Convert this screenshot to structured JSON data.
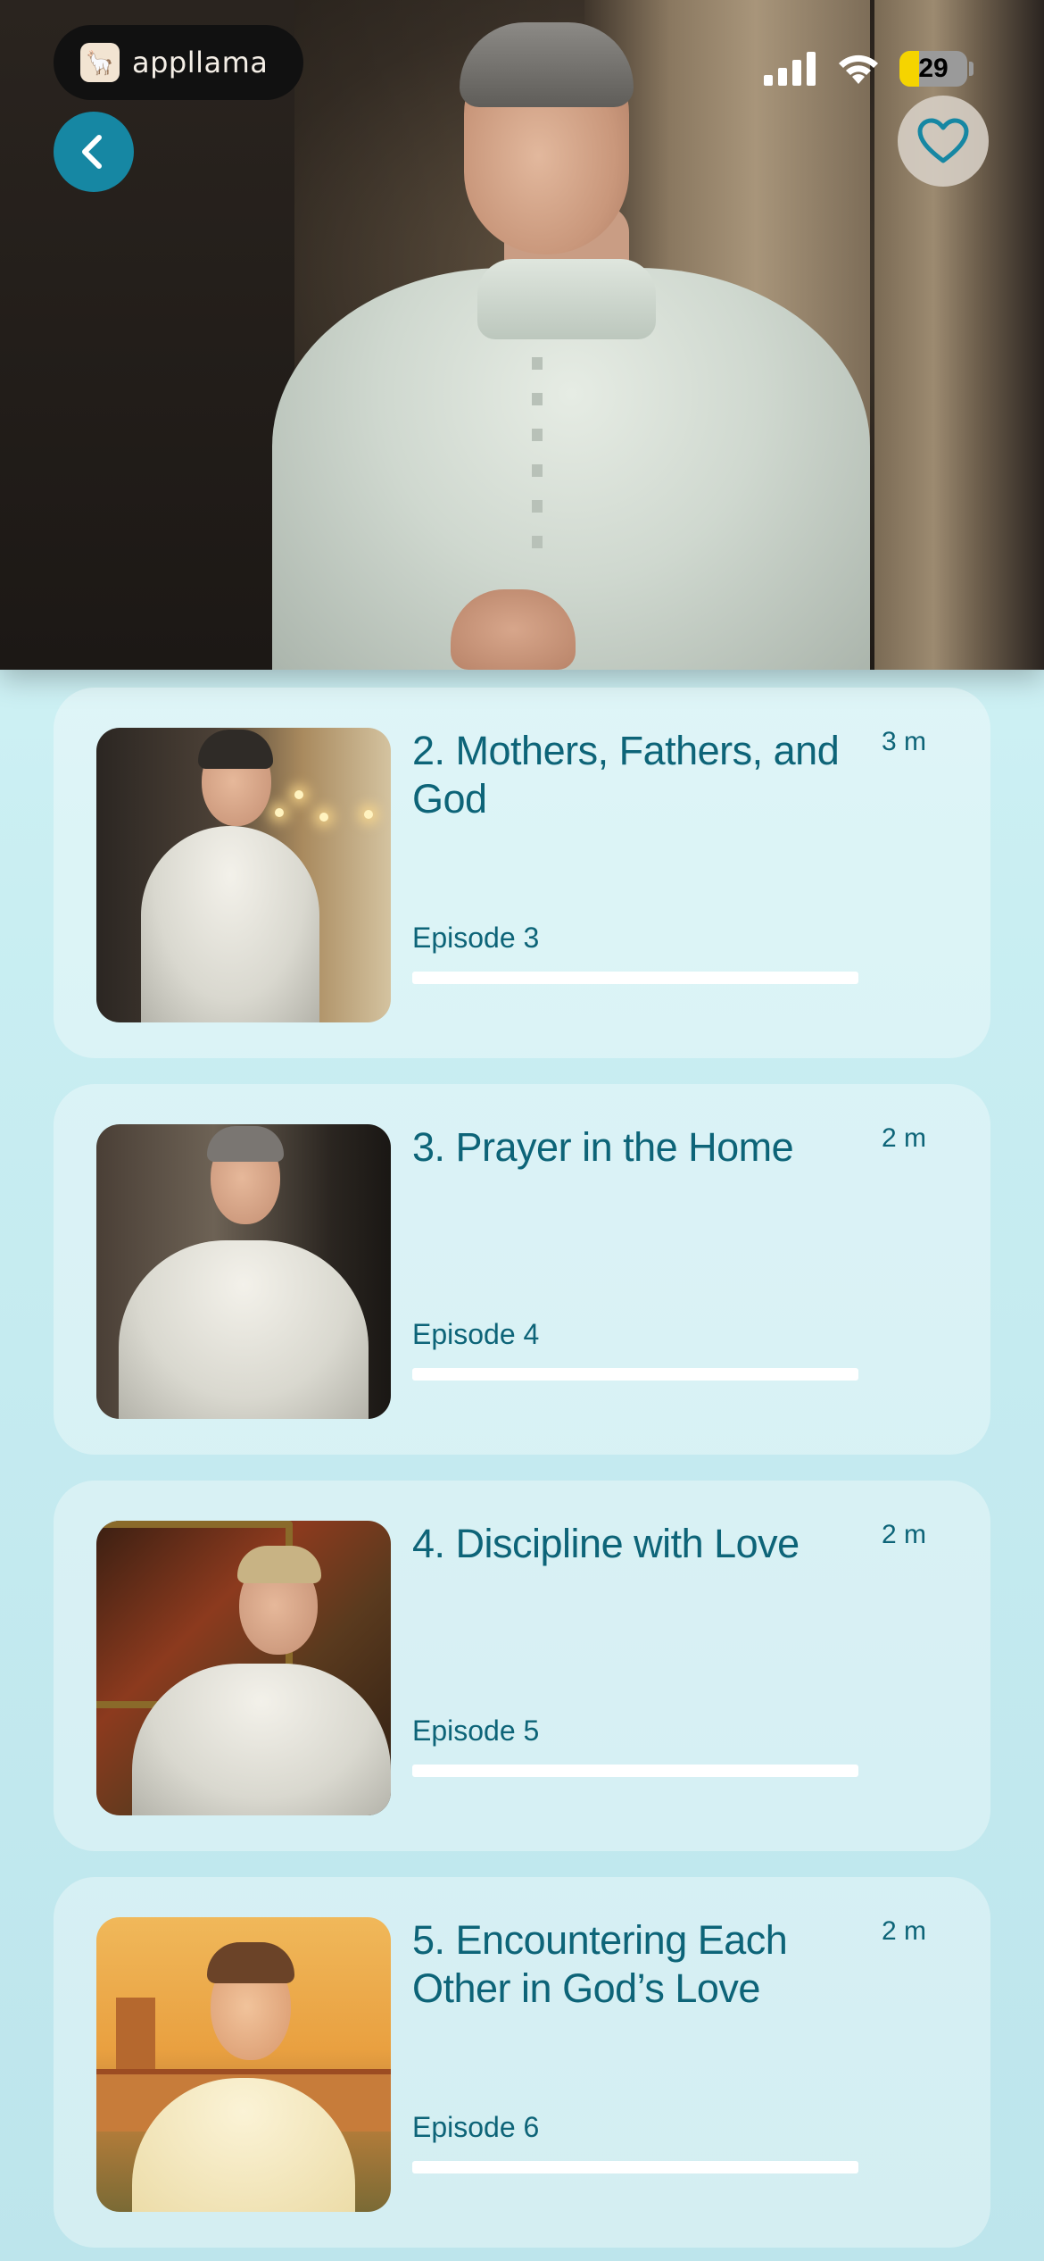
{
  "status_bar": {
    "app_logo_text": "appllama",
    "battery_level": "29",
    "battery_fraction": 0.29
  },
  "hero": {
    "back_icon": "chevron-left-icon",
    "favorite_icon": "heart-outline-icon"
  },
  "colors": {
    "accent": "#1687a3",
    "title_text": "#0d6478",
    "background": "#c9eef2"
  },
  "episodes": [
    {
      "title": "2. Mothers, Fathers, and God",
      "duration": "3 m",
      "episode_label": "Episode 3",
      "progress": 0
    },
    {
      "title": "3. Prayer in the Home",
      "duration": "2 m",
      "episode_label": "Episode 4",
      "progress": 0
    },
    {
      "title": "4. Discipline with Love",
      "duration": "2 m",
      "episode_label": "Episode 5",
      "progress": 0
    },
    {
      "title": "5. Encountering Each Other in God’s Love",
      "duration": "2 m",
      "episode_label": "Episode 6",
      "progress": 0
    }
  ]
}
